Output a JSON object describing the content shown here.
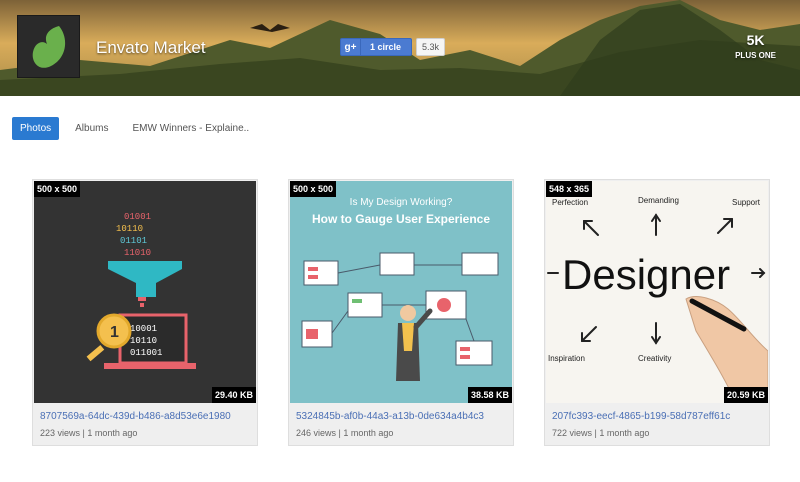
{
  "header": {
    "brand": "Envato Market",
    "gplus": {
      "icon": "google-plus-icon",
      "label": "1 circle",
      "count": "5.3k"
    },
    "plusone": {
      "value": "5K",
      "label": "PLUS ONE"
    }
  },
  "tabs": [
    {
      "label": "Photos",
      "active": true
    },
    {
      "label": "Albums",
      "active": false
    },
    {
      "label": "EMW Winners - Explaine..",
      "active": false
    }
  ],
  "cards": [
    {
      "dims": "500 x 500",
      "size": "29.40 KB",
      "name": "8707569a-64dc-439d-b486-a8d53e6e1980",
      "meta": "223 views | 1 month ago",
      "binary": [
        "01001",
        "10110",
        "01101",
        "11010"
      ],
      "screen_rows": [
        "10001",
        "10110",
        "011001"
      ],
      "badge": "1"
    },
    {
      "dims": "500 x 500",
      "size": "38.58 KB",
      "name": "5324845b-af0b-44a3-a13b-0de634a4b4c3",
      "meta": "246 views | 1 month ago",
      "subtitle": "Is My Design Working?",
      "title": "How to Gauge User Experience"
    },
    {
      "dims": "548 x 365",
      "size": "20.59 KB",
      "name": "207fc393-eecf-4865-b199-58d787eff61c",
      "meta": "722 views | 1 month ago",
      "word": "Designer",
      "labels": {
        "top_left": "Perfection",
        "top_mid": "Demanding",
        "top_right": "Support",
        "bottom_left": "Inspiration",
        "bottom_mid": "Creativity"
      }
    }
  ],
  "colors": {
    "accent": "#2a7ad1",
    "link": "#4a6fb5",
    "gplus": "#4b7bd1",
    "logo_leaf": "#6ab04c"
  }
}
